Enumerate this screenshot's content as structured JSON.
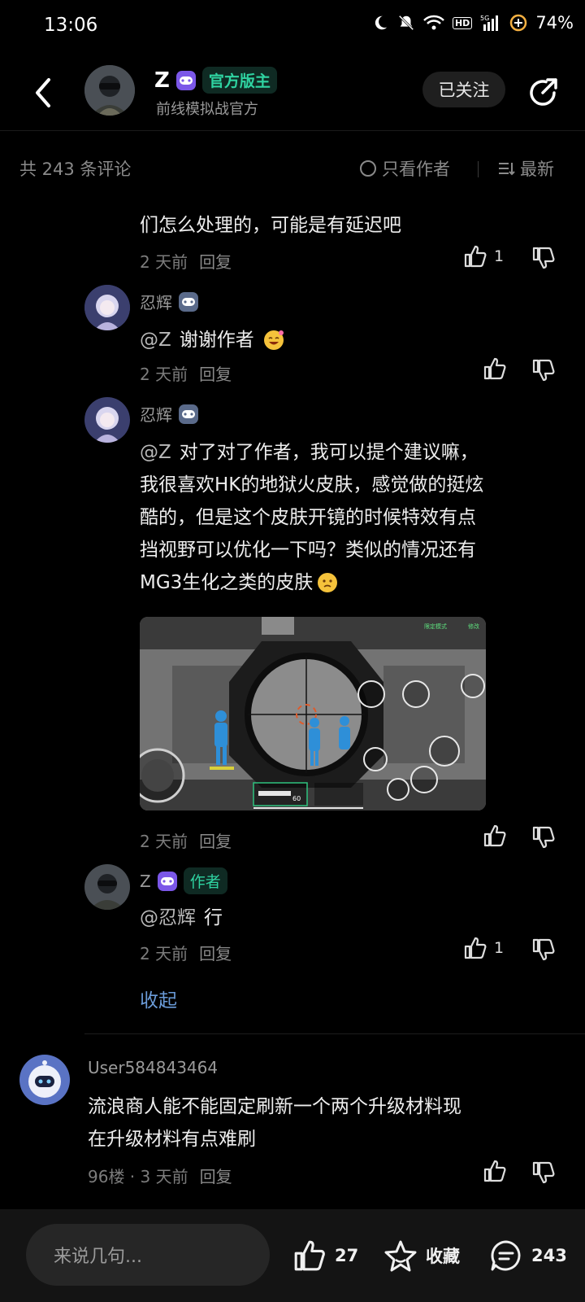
{
  "status_bar": {
    "time": "13:06",
    "battery": "74%",
    "network": "5G",
    "hd": "HD"
  },
  "header": {
    "author_name": "Z",
    "role_tag": "官方版主",
    "subtitle": "前线模拟战官方",
    "follow_label": "已关注"
  },
  "filter": {
    "count_label": "共 243 条评论",
    "only_author_label": "只看作者",
    "sort_label": "最新"
  },
  "comments": [
    {
      "text": "们怎么处理的，可能是有延迟吧",
      "time": "2 天前",
      "reply": "回复",
      "likes": "1"
    },
    {
      "user": "忍辉",
      "mention": "@Z",
      "text": "谢谢作者",
      "time": "2 天前",
      "reply": "回复",
      "likes": ""
    },
    {
      "user": "忍辉",
      "mention": "@Z",
      "text_lines": [
        "对了对了作者，我可以提个建议嘛，",
        "我很喜欢HK的地狱火皮肤，感觉做的挺炫",
        "酷的，但是这个皮肤开镜的时候特效有点",
        "挡视野可以优化一下吗？类似的情况还有",
        "MG3生化之类的皮肤"
      ],
      "time": "2 天前",
      "reply": "回复",
      "likes": "",
      "image_hud": {
        "mode": "限定模式",
        "edit": "修改",
        "ammo": "60"
      }
    },
    {
      "user": "Z",
      "author_tag": "作者",
      "mention": "@忍辉",
      "text": "行",
      "time": "2 天前",
      "reply": "回复",
      "likes": "1"
    }
  ],
  "collapse_label": "收起",
  "floor_comment": {
    "user": "User584843464",
    "text_lines": [
      "流浪商人能不能固定刷新一个两个升级材料现",
      "在升级材料有点难刷"
    ],
    "floor_time": "96楼 · 3 天前",
    "reply": "回复"
  },
  "bottom_bar": {
    "input_placeholder": "来说几句...",
    "likes": "27",
    "favorite_label": "收藏",
    "comments": "243"
  },
  "colors": {
    "accent_green": "#2fd3a1",
    "link_blue": "#6a9bd8",
    "badge_purple": "#7b57e8"
  }
}
